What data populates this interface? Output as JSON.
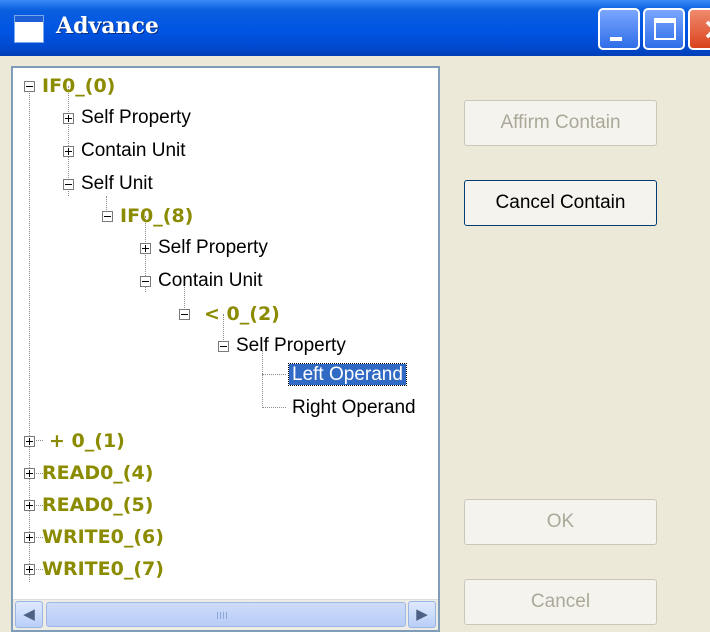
{
  "window": {
    "title": "Advance"
  },
  "tree": {
    "nodes": [
      {
        "label": "IF0_(0)",
        "level": 0,
        "toggle": "-",
        "bold": true
      },
      {
        "label": "Self Property",
        "level": 1,
        "toggle": "+",
        "bold": false
      },
      {
        "label": "Contain Unit",
        "level": 1,
        "toggle": "+",
        "bold": false
      },
      {
        "label": "Self Unit",
        "level": 1,
        "toggle": "-",
        "bold": false
      },
      {
        "label": "IF0_(8)",
        "level": 2,
        "toggle": "-",
        "bold": true
      },
      {
        "label": "Self Property",
        "level": 3,
        "toggle": "+",
        "bold": false
      },
      {
        "label": "Contain Unit",
        "level": 3,
        "toggle": "-",
        "bold": false
      },
      {
        "label": "< 0_(2)",
        "level": 4,
        "toggle": "-",
        "bold": true
      },
      {
        "label": "Self Property",
        "level": 5,
        "toggle": "-",
        "bold": false
      },
      {
        "label": "Left Operand",
        "level": 6,
        "toggle": "",
        "bold": false,
        "selected": true
      },
      {
        "label": "Right Operand",
        "level": 6,
        "toggle": "",
        "bold": false
      },
      {
        "label": "+ 0_(1)",
        "level": 0,
        "toggle": "+",
        "bold": true
      },
      {
        "label": "READ0_(4)",
        "level": 0,
        "toggle": "+",
        "bold": true
      },
      {
        "label": "READ0_(5)",
        "level": 0,
        "toggle": "+",
        "bold": true
      },
      {
        "label": "WRITE0_(6)",
        "level": 0,
        "toggle": "+",
        "bold": true
      },
      {
        "label": "WRITE0_(7)",
        "level": 0,
        "toggle": "+",
        "bold": true
      }
    ]
  },
  "buttons": {
    "affirm_contain": "Affirm Contain",
    "cancel_contain": "Cancel Contain",
    "ok": "OK",
    "cancel": "Cancel"
  },
  "scrollbar": {
    "grip": "III"
  }
}
